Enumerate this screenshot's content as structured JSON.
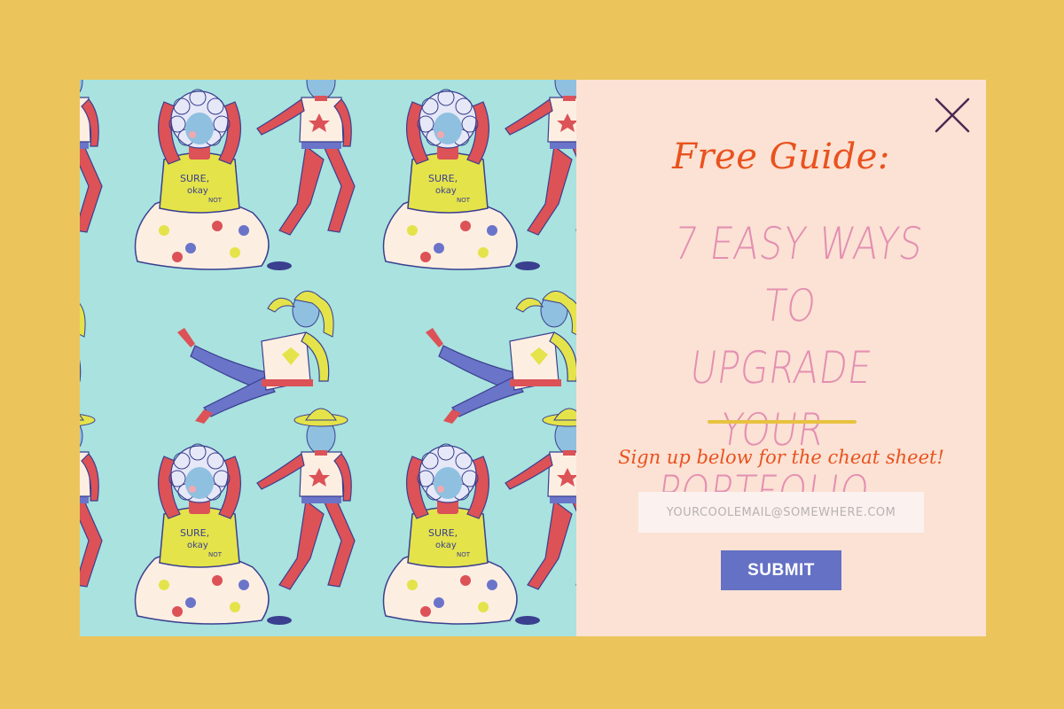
{
  "colors": {
    "page_background": "#ebc55c",
    "art_background": "#a9e2df",
    "panel_background": "#fbe2d4",
    "eyebrow": "#e9521e",
    "headline": "#e38fb2",
    "divider": "#e8c23f",
    "subtitle": "#e9521e",
    "submit_button": "#6471c4",
    "close_icon": "#4a2a52"
  },
  "illustration": {
    "shirt_text_line1": "SURE,",
    "shirt_text_line2": "okay",
    "shirt_text_line3": "NOT"
  },
  "close_icon": "close-icon",
  "popup": {
    "eyebrow": "Free Guide:",
    "headline_lines": [
      "7 EASY WAYS TO",
      "UPGRADE YOUR",
      "PORTFOLIO"
    ],
    "subtitle": "Sign up below for the cheat sheet!",
    "email_placeholder": "YOURCOOLEMAIL@SOMEWHERE.COM",
    "email_value": "",
    "submit_label": "SUBMIT"
  }
}
